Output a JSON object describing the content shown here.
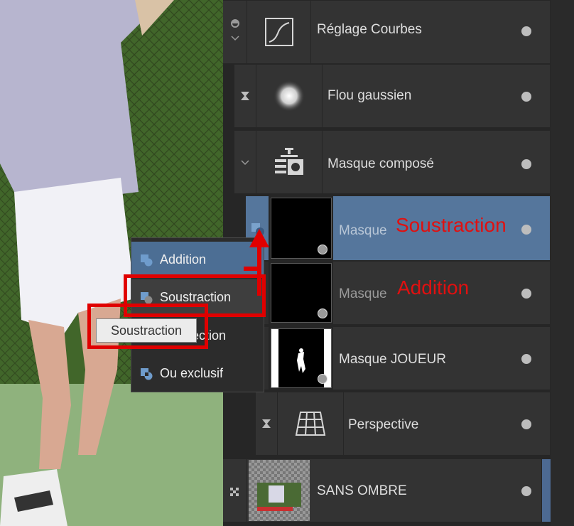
{
  "layers": [
    {
      "name": "Réglage Courbes",
      "icon": "curves-icon"
    },
    {
      "name": "Flou gaussien",
      "icon": "gaussian-blur-icon"
    },
    {
      "name": "Masque composé",
      "icon": "compound-mask-icon"
    },
    {
      "name": "Masque",
      "state": "selected"
    },
    {
      "name": "Masque"
    },
    {
      "name": "Masque JOUEUR"
    },
    {
      "name": "Perspective",
      "icon": "perspective-grid-icon"
    },
    {
      "name": "SANS OMBRE"
    }
  ],
  "menu": {
    "items": [
      {
        "label": "Addition",
        "icon": "add-mode-icon"
      },
      {
        "label": "Soustraction",
        "icon": "subtract-mode-icon"
      },
      {
        "label": "Intersection",
        "icon": "intersect-mode-icon"
      },
      {
        "label": "Ou exclusif",
        "icon": "xor-mode-icon"
      }
    ]
  },
  "tooltip": "Soustraction",
  "annotations": {
    "soustraction": "Soustraction",
    "addition": "Addition"
  },
  "colors": {
    "accent": "#55769c",
    "annotation_red": "#e00000"
  }
}
